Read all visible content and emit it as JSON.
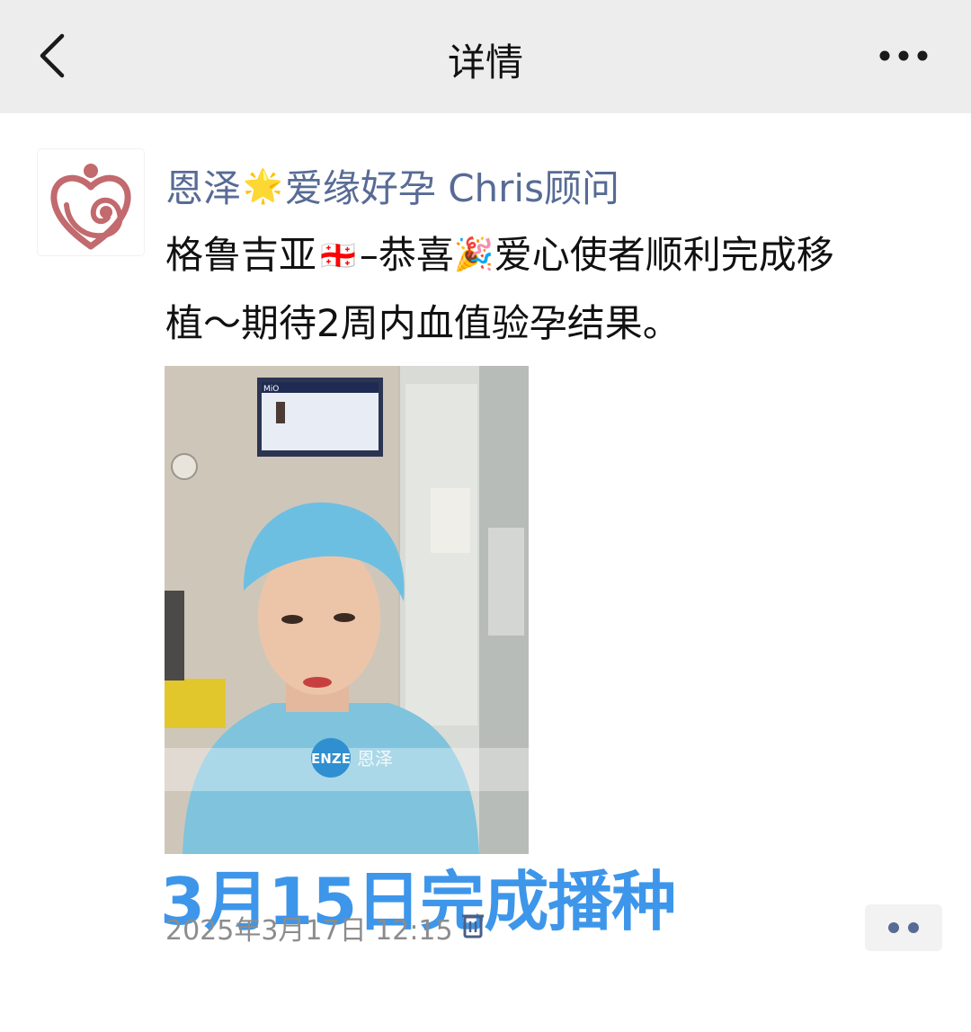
{
  "navbar": {
    "title": "详情",
    "back_icon": "chevron-left-icon",
    "more_icon": "more-horizontal-icon"
  },
  "post": {
    "author_part1": "恩泽",
    "author_star": "🌟",
    "author_part2": "爱缘好孕 Chris顾问",
    "text_line1_a": "格鲁吉亚",
    "text_flag": "🇬🇪",
    "text_line1_b": "–恭喜",
    "text_party": "🎉",
    "text_line1_c": "爱心使者顺利完成移",
    "text_line2": "植～期待2周内血值验孕结果。",
    "photo_watermark_logo": "ENZE",
    "photo_watermark_text": "恩泽",
    "photo_monitor_text": "MiO",
    "overlay_caption": "3月15日完成播种",
    "timestamp": "2025年3月17日 12:15",
    "delete_icon": "trash-icon",
    "action_icon": "comment-more-icon"
  },
  "colors": {
    "navbar_bg": "#ededed",
    "author": "#576b95",
    "caption": "#3d96ea",
    "timestamp": "#8c8c8c",
    "logo": "#c26a6e"
  }
}
